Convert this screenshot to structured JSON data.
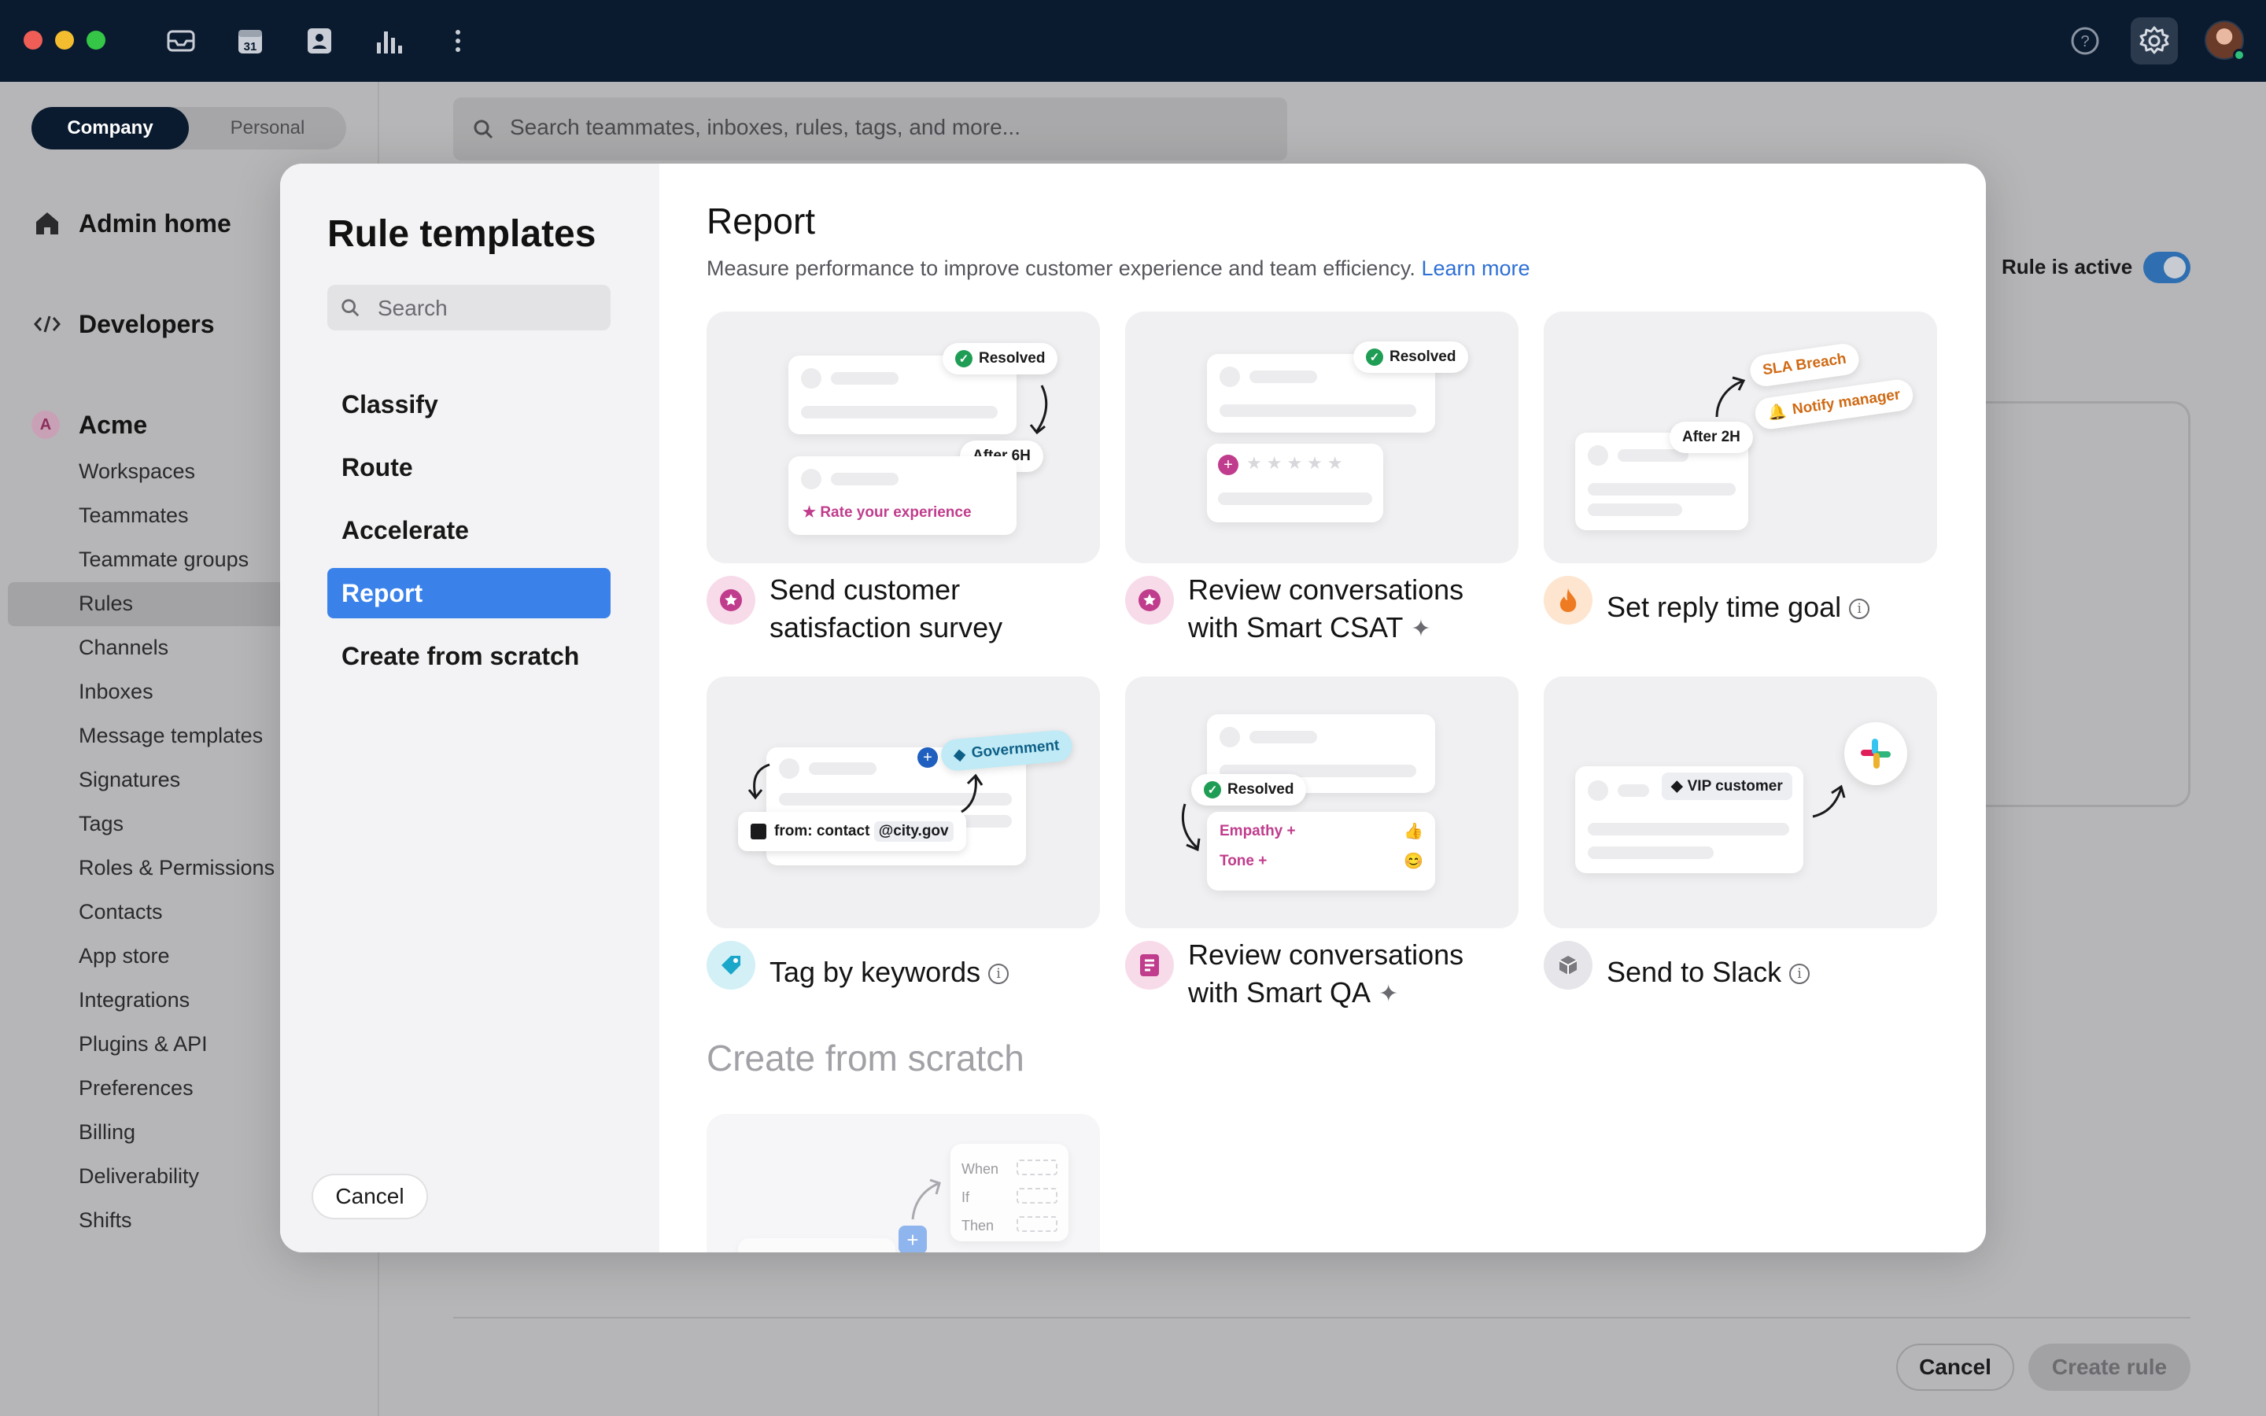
{
  "topbar": {
    "icons": [
      "inbox-icon",
      "calendar-icon",
      "contacts-icon",
      "analytics-icon",
      "more-icon"
    ],
    "calendar_day": "31",
    "right_icons": [
      "help-icon",
      "settings-icon"
    ]
  },
  "sidebar": {
    "segment": {
      "company": "Company",
      "personal": "Personal"
    },
    "admin_home": "Admin home",
    "developers": "Developers",
    "org_badge": "A",
    "org": "Acme",
    "items": [
      "Workspaces",
      "Teammates",
      "Teammate groups",
      "Rules",
      "Channels",
      "Inboxes",
      "Message templates",
      "Signatures",
      "Tags",
      "Roles & Permissions",
      "Contacts",
      "App store",
      "Integrations",
      "Plugins & API",
      "Preferences",
      "Billing",
      "Deliverability",
      "Shifts"
    ],
    "selected": "Rules"
  },
  "background": {
    "search_placeholder": "Search teammates, inboxes, rules, tags, and more...",
    "rule_active_label": "Rule is active",
    "cancel": "Cancel",
    "create_rule": "Create rule"
  },
  "modal": {
    "title": "Rule templates",
    "search_placeholder": "Search",
    "categories": [
      "Classify",
      "Route",
      "Accelerate",
      "Report",
      "Create from scratch"
    ],
    "active_category": "Report",
    "cancel": "Cancel",
    "section_title": "Report",
    "section_desc": "Measure performance to improve customer experience and team efficiency.",
    "learn_more": "Learn more",
    "cards": [
      {
        "title": "Send customer satisfaction survey",
        "pill_resolved": "Resolved",
        "pill_after": "After 6H",
        "rate": "Rate your experience"
      },
      {
        "title": "Review conversations with Smart CSAT",
        "pill_resolved": "Resolved"
      },
      {
        "title": "Set reply time goal",
        "sla": "SLA Breach",
        "notify": "Notify manager",
        "after": "After 2H"
      },
      {
        "title": "Tag by keywords",
        "tag": "Government",
        "from": "from: contact",
        "domain": "@city.gov"
      },
      {
        "title": "Review conversations with Smart QA",
        "pill_resolved": "Resolved",
        "empathy": "Empathy +",
        "tone": "Tone +"
      },
      {
        "title": "Send to Slack",
        "vip": "VIP customer"
      }
    ],
    "scratch_title": "Create from scratch",
    "scratch_labels": [
      "When",
      "If",
      "Then"
    ]
  },
  "colors": {
    "accent": "#3a82ea",
    "topbar": "#0a1a2f",
    "link": "#2d6fd6"
  }
}
